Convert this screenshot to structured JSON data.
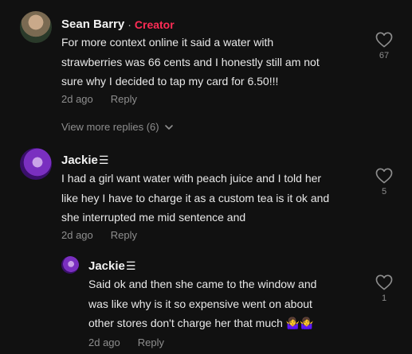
{
  "comments": [
    {
      "author": "Sean Barry",
      "separator": "·",
      "badge": "Creator",
      "lines": [
        "For more context online it said a water with",
        "strawberries was 66 cents and I honestly still am not",
        "sure why I decided to tap my card for 6.50!!!"
      ],
      "age": "2d ago",
      "reply_label": "Reply",
      "likes": "67",
      "view_more": "View more replies (6)"
    },
    {
      "author": "Jackie",
      "author_suffix": "☰",
      "lines": [
        "I had a girl want water with peach juice and I told her",
        "like hey I have to charge it as a custom tea is it ok and",
        "she interrupted me mid sentence and"
      ],
      "age": "2d ago",
      "reply_label": "Reply",
      "likes": "5"
    },
    {
      "author": "Jackie",
      "author_suffix": "☰",
      "lines": [
        "Said ok and then she came to the window and",
        "was like why is it so expensive went on about",
        "other stores don't charge her that much 🤷‍♀️🤷‍♀️"
      ],
      "age": "2d ago",
      "reply_label": "Reply",
      "likes": "1"
    }
  ],
  "colors": {
    "background": "#111111",
    "creator_badge": "#fe2c55",
    "muted": "#8e8e8e"
  },
  "icons": {
    "like": "heart-outline-icon",
    "expand": "chevron-down-icon"
  }
}
